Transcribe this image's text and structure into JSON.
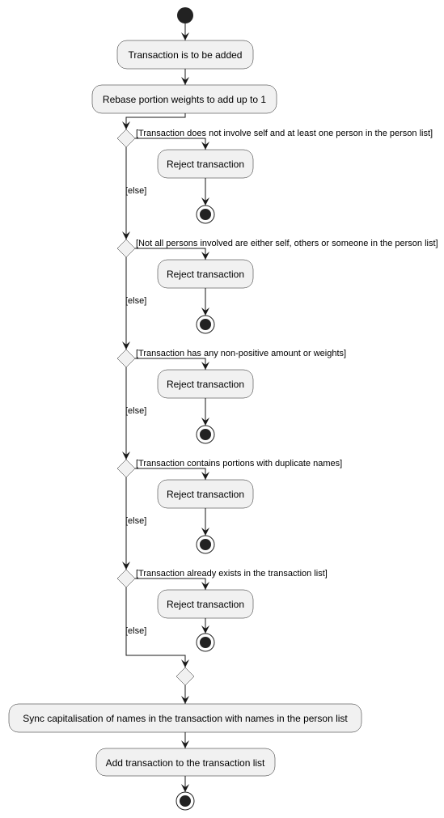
{
  "diagram": {
    "type": "activity",
    "start_activities": [
      "Transaction is to be added",
      "Rebase portion weights to add up to 1"
    ],
    "decisions": [
      {
        "guard": "[Transaction does not involve self and at least one person in the person list]",
        "action": "Reject transaction",
        "else": "[else]"
      },
      {
        "guard": "[Not all persons involved are either self, others or someone in the person list]",
        "action": "Reject transaction",
        "else": "[else]"
      },
      {
        "guard": "[Transaction has any non-positive amount or weights]",
        "action": "Reject transaction",
        "else": "[else]"
      },
      {
        "guard": "[Transaction contains portions with duplicate names]",
        "action": "Reject transaction",
        "else": "[else]"
      },
      {
        "guard": "[Transaction already exists in the transaction list]",
        "action": "Reject transaction",
        "else": "[else]"
      }
    ],
    "end_activities": [
      "Sync capitalisation of names in the transaction with names in the person list",
      "Add transaction to the transaction list"
    ],
    "colors": {
      "node_fill": "#f1f1f1",
      "line": "#181818"
    }
  }
}
